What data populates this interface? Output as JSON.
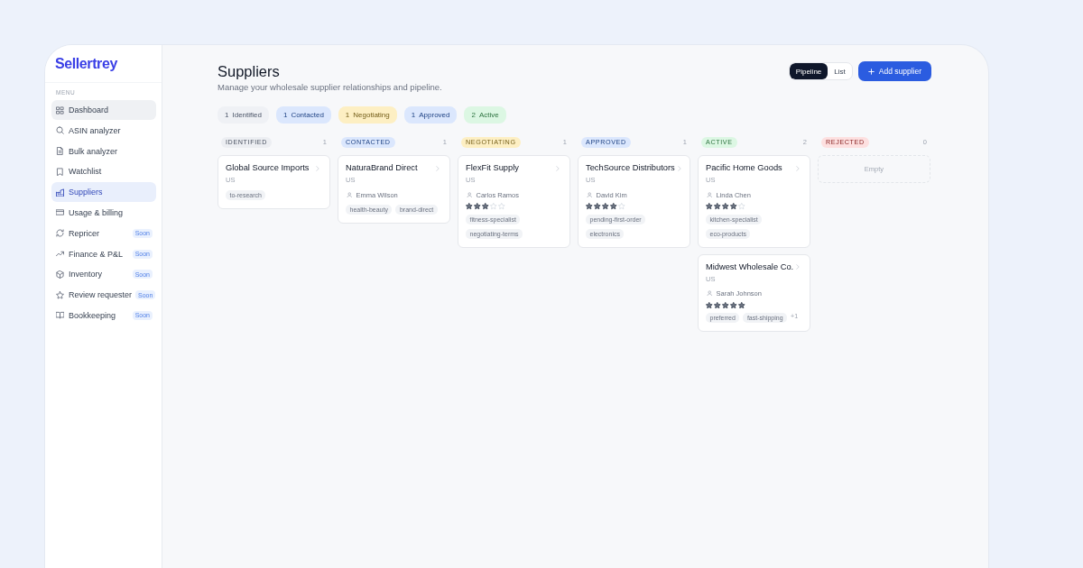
{
  "sidebar": {
    "logo": "Sellertrey",
    "section_label": "MENU",
    "items": [
      {
        "label": "Dashboard",
        "selected": false,
        "hovered": true
      },
      {
        "label": "ASIN analyzer",
        "selected": false,
        "hovered": false
      },
      {
        "label": "Bulk analyzer",
        "selected": false,
        "hovered": false
      },
      {
        "label": "Watchlist",
        "selected": false,
        "hovered": false
      },
      {
        "label": "Suppliers",
        "selected": true,
        "hovered": false
      },
      {
        "label": "Usage & billing",
        "selected": false,
        "hovered": false
      },
      {
        "label": "Repricer",
        "selected": false,
        "hovered": false,
        "badge": "Soon"
      },
      {
        "label": "Finance & P&L",
        "selected": false,
        "hovered": false,
        "badge": "Soon"
      },
      {
        "label": "Inventory",
        "selected": false,
        "hovered": false,
        "badge": "Soon"
      },
      {
        "label": "Review requester",
        "selected": false,
        "hovered": false,
        "badge": "Soon"
      },
      {
        "label": "Bookkeeping",
        "selected": false,
        "hovered": false,
        "badge": "Soon"
      }
    ]
  },
  "header": {
    "title": "Suppliers",
    "subtitle": "Manage your wholesale supplier relationships and pipeline.",
    "view_toggle": [
      {
        "label": "Pipeline",
        "selected": true
      },
      {
        "label": "List",
        "selected": false
      }
    ],
    "add_button": "Add supplier"
  },
  "summary_chips": [
    {
      "count": "1",
      "label": "Identified",
      "color": "#eff1f5"
    },
    {
      "count": "1",
      "label": "Contacted",
      "color": "#dbe7fd"
    },
    {
      "count": "1",
      "label": "Negotiating",
      "color": "#fdefc3"
    },
    {
      "count": "1",
      "label": "Approved",
      "color": "#dbe7fd"
    },
    {
      "count": "2",
      "label": "Active",
      "color": "#dcf7e3"
    }
  ],
  "columns": [
    {
      "title": "IDENTIFIED",
      "count": "1",
      "color": "#eceef2",
      "cards": [
        {
          "name": "Global Source Imports",
          "country": "US",
          "tags": [
            "to-research"
          ]
        }
      ]
    },
    {
      "title": "CONTACTED",
      "count": "1",
      "color": "#dbe7fd",
      "cards": [
        {
          "name": "NaturaBrand Direct",
          "country": "US",
          "contact": "Emma Wilson",
          "tags": [
            "health-beauty",
            "brand-direct"
          ]
        }
      ]
    },
    {
      "title": "NEGOTIATING",
      "count": "1",
      "color": "#fdefc3",
      "cards": [
        {
          "name": "FlexFit Supply",
          "country": "US",
          "contact": "Carlos Ramos",
          "stars": 3,
          "tags": [
            "fitness-specialist",
            "negotiating-terms"
          ]
        }
      ]
    },
    {
      "title": "APPROVED",
      "count": "1",
      "color": "#dbe7fd",
      "cards": [
        {
          "name": "TechSource Distributors",
          "country": "US",
          "contact": "David Kim",
          "stars": 4,
          "tags": [
            "pending-first-order",
            "electronics"
          ]
        }
      ]
    },
    {
      "title": "ACTIVE",
      "count": "2",
      "color": "#dcf7e3",
      "cards": [
        {
          "name": "Pacific Home Goods",
          "country": "US",
          "contact": "Linda Chen",
          "stars": 4,
          "tags": [
            "kitchen-specialist",
            "eco-products"
          ]
        },
        {
          "name": "Midwest Wholesale Co.",
          "country": "US",
          "contact": "Sarah Johnson",
          "stars": 5,
          "tags": [
            "preferred",
            "fast-shipping"
          ],
          "more_tags": "+1"
        }
      ]
    },
    {
      "title": "REJECTED",
      "count": "0",
      "color": "#fde0e0",
      "empty_text": "Empty"
    }
  ]
}
